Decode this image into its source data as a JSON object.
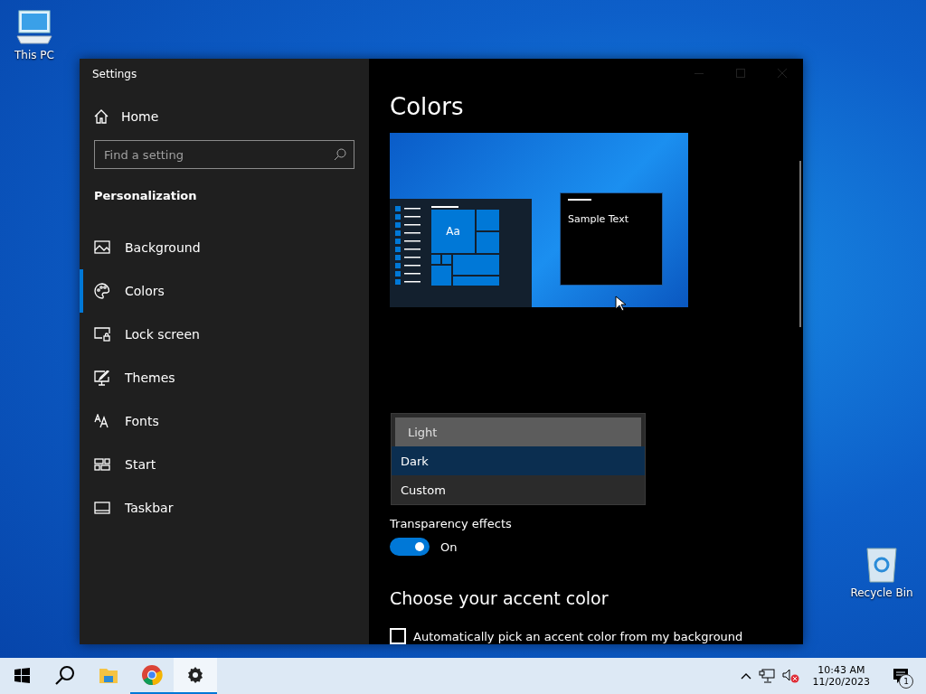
{
  "desktop_icons": [
    {
      "label": "This PC"
    },
    {
      "label": "Recycle Bin"
    }
  ],
  "window": {
    "title": "Settings"
  },
  "sidebar": {
    "home": "Home",
    "search": {
      "placeholder": "Find a setting"
    },
    "section": "Personalization",
    "items": [
      {
        "label": "Background",
        "selected": false
      },
      {
        "label": "Colors",
        "selected": true
      },
      {
        "label": "Lock screen",
        "selected": false
      },
      {
        "label": "Themes",
        "selected": false
      },
      {
        "label": "Fonts",
        "selected": false
      },
      {
        "label": "Start",
        "selected": false
      },
      {
        "label": "Taskbar",
        "selected": false
      }
    ]
  },
  "content": {
    "title": "Colors",
    "preview": {
      "sample_text": "Sample Text",
      "tile_label": "Aa"
    },
    "mode_dropdown": {
      "options": [
        {
          "label": "Light",
          "selected": false,
          "hovered": true
        },
        {
          "label": "Dark",
          "selected": true,
          "hovered": false
        },
        {
          "label": "Custom",
          "selected": false,
          "hovered": false
        }
      ]
    },
    "transparency": {
      "label": "Transparency effects",
      "on": true,
      "state_text": "On"
    },
    "accent_heading": "Choose your accent color",
    "auto_pick": {
      "label": "Automatically pick an accent color from my background",
      "checked": false
    }
  },
  "taskbar": {
    "apps": [
      {
        "running": false,
        "selected": false
      },
      {
        "running": true,
        "selected": false
      },
      {
        "running": true,
        "selected": true
      }
    ],
    "time": "10:43 AM",
    "date": "11/20/2023",
    "notification_count": "1"
  }
}
